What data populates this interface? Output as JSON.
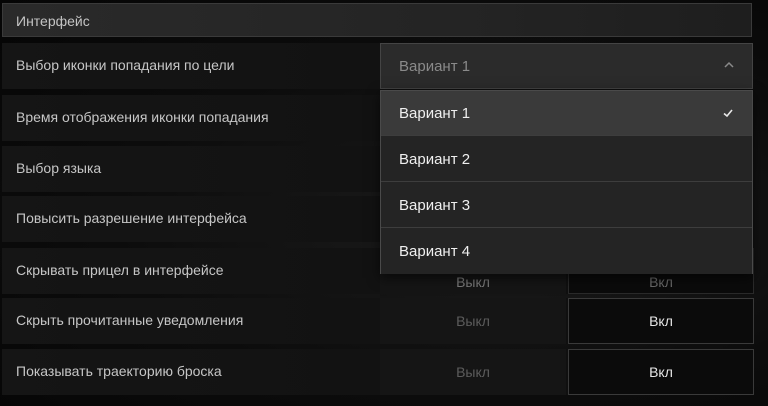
{
  "section": {
    "title": "Интерфейс"
  },
  "settings": [
    {
      "label": "Выбор иконки попадания по цели"
    },
    {
      "label": "Время отображения иконки попадания"
    },
    {
      "label": "Выбор языка"
    },
    {
      "label": "Повысить разрешение интерфейса"
    },
    {
      "label": "Скрывать прицел в интерфейсе",
      "off": "Выкл",
      "on": "Вкл"
    },
    {
      "label": "Скрыть прочитанные уведомления",
      "off": "Выкл",
      "on": "Вкл"
    },
    {
      "label": "Показывать траекторию броска",
      "off": "Выкл",
      "on": "Вкл"
    }
  ],
  "select": {
    "value": "Вариант 1",
    "options": [
      "Вариант 1",
      "Вариант 2",
      "Вариант 3",
      "Вариант 4"
    ],
    "selected_index": 0
  },
  "icons": {
    "chevron": "chevron-up-icon",
    "check": "checkmark-icon"
  },
  "colors": {
    "accent_text": "#efefef",
    "muted_text": "#5c5c5c"
  }
}
